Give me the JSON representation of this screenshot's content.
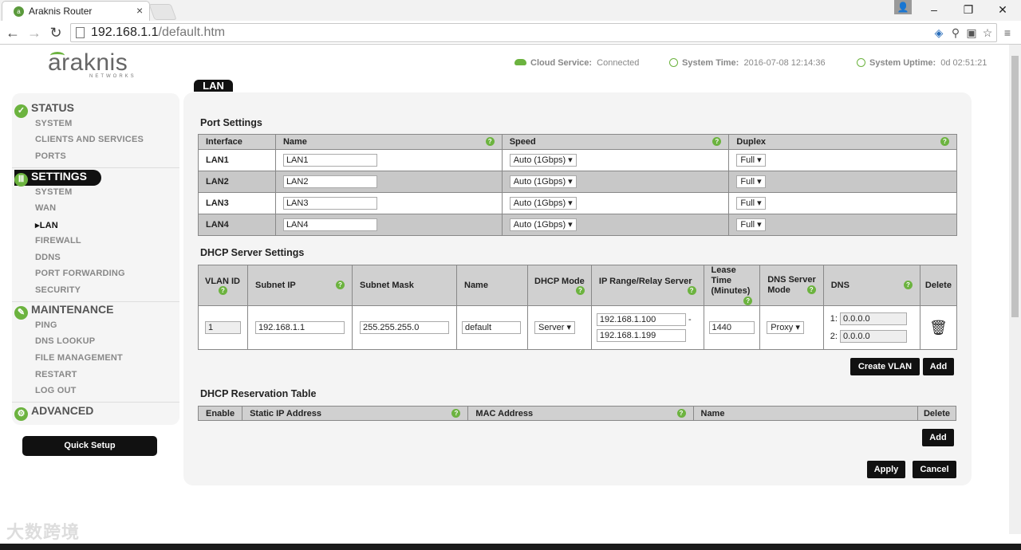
{
  "browser": {
    "tab_title": "Araknis Router",
    "url_host": "192.168.1.1",
    "url_path": "/default.htm"
  },
  "header": {
    "logo_text": "araknis",
    "logo_sub": "NETWORKS",
    "cloud_label": "Cloud Service:",
    "cloud_value": "Connected",
    "time_label": "System Time:",
    "time_value": "2016-07-08 12:14:36",
    "uptime_label": "System Uptime:",
    "uptime_value": "0d 02:51:21"
  },
  "sidebar": {
    "status": {
      "label": "STATUS",
      "items": [
        "SYSTEM",
        "CLIENTS AND SERVICES",
        "PORTS"
      ]
    },
    "settings": {
      "label": "SETTINGS",
      "items": [
        "SYSTEM",
        "WAN",
        "LAN",
        "FIREWALL",
        "DDNS",
        "PORT FORWARDING",
        "SECURITY"
      ]
    },
    "maintenance": {
      "label": "MAINTENANCE",
      "items": [
        "PING",
        "DNS LOOKUP",
        "FILE MANAGEMENT",
        "RESTART",
        "LOG OUT"
      ]
    },
    "advanced": {
      "label": "ADVANCED"
    },
    "quick_setup": "Quick Setup"
  },
  "page_tab": "LAN",
  "port_settings": {
    "title": "Port Settings",
    "headers": [
      "Interface",
      "Name",
      "Speed",
      "Duplex"
    ],
    "rows": [
      {
        "iface": "LAN1",
        "name": "LAN1",
        "speed": "Auto (1Gbps)",
        "duplex": "Full"
      },
      {
        "iface": "LAN2",
        "name": "LAN2",
        "speed": "Auto (1Gbps)",
        "duplex": "Full"
      },
      {
        "iface": "LAN3",
        "name": "LAN3",
        "speed": "Auto (1Gbps)",
        "duplex": "Full"
      },
      {
        "iface": "LAN4",
        "name": "LAN4",
        "speed": "Auto (1Gbps)",
        "duplex": "Full"
      }
    ]
  },
  "dhcp": {
    "title": "DHCP Server Settings",
    "headers": {
      "vlan_id": "VLAN ID",
      "subnet_ip": "Subnet IP",
      "subnet_mask": "Subnet Mask",
      "name": "Name",
      "dhcp_mode": "DHCP Mode",
      "ip_range": "IP Range/Relay Server",
      "lease_1": "Lease",
      "lease_2": "Time",
      "lease_3": "(Minutes)",
      "dns_mode_1": "DNS Server",
      "dns_mode_2": "Mode",
      "dns": "DNS",
      "delete": "Delete"
    },
    "row": {
      "vlan_id": "1",
      "subnet_ip": "192.168.1.1",
      "subnet_mask": "255.255.255.0",
      "name": "default",
      "dhcp_mode": "Server",
      "range_start": "192.168.1.100",
      "range_dash": "-",
      "range_end": "192.168.1.199",
      "lease": "1440",
      "dns_mode": "Proxy",
      "dns1_label": "1:",
      "dns1": "0.0.0.0",
      "dns2_label": "2:",
      "dns2": "0.0.0.0"
    },
    "create_vlan": "Create VLAN",
    "add": "Add"
  },
  "reservation": {
    "title": "DHCP Reservation Table",
    "headers": [
      "Enable",
      "Static IP Address",
      "MAC Address",
      "Name",
      "Delete"
    ],
    "add": "Add"
  },
  "actions": {
    "apply": "Apply",
    "cancel": "Cancel"
  },
  "watermark": "大数跨境",
  "icons": {
    "help": "?",
    "trash": "🗑",
    "check": "✓"
  },
  "colors": {
    "accent": "#6cb33f",
    "dark": "#111111"
  }
}
